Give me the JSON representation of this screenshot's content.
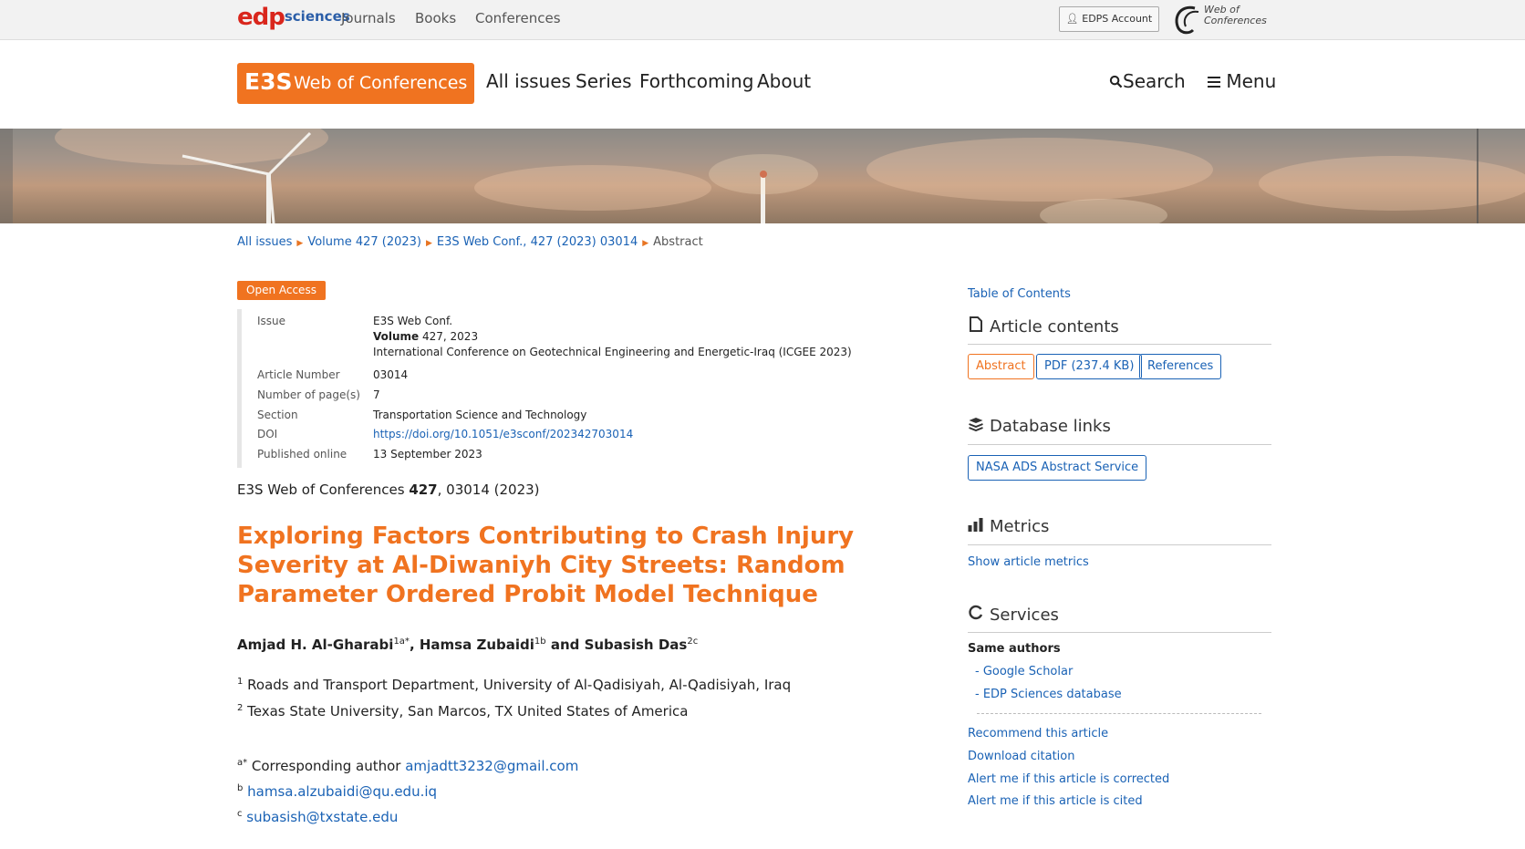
{
  "topbar": {
    "logo_main": "edp",
    "logo_suffix": "sciences",
    "nav": [
      "Journals",
      "Books",
      "Conferences"
    ],
    "account_label": "EDPS Account",
    "woc_logo_line1": "Web of",
    "woc_logo_line2": "Conferences"
  },
  "header": {
    "brand_e3s": "E3S",
    "brand_name": "Web of Conferences",
    "nav": [
      "All issues",
      "Series",
      "Forthcoming",
      "About"
    ],
    "search_label": "Search",
    "menu_label": "Menu"
  },
  "breadcrumb": [
    "All issues",
    "Volume 427 (2023)",
    "E3S Web Conf., 427 (2023) 03014",
    "Abstract"
  ],
  "badge": "Open Access",
  "meta": {
    "issue_label": "Issue",
    "issue_line1": "E3S Web Conf.",
    "issue_volume_bold": "Volume",
    "issue_volume_rest": " 427, 2023",
    "issue_line3": "International Conference on Geotechnical Engineering and Energetic-Iraq (ICGEE 2023)",
    "article_number_label": "Article Number",
    "article_number": "03014",
    "pages_label": "Number of page(s)",
    "pages": "7",
    "section_label": "Section",
    "section": "Transportation Science and Technology",
    "doi_label": "DOI",
    "doi": "https://doi.org/10.1051/e3sconf/202342703014",
    "published_label": "Published online",
    "published": "13 September 2023"
  },
  "citation": {
    "prefix": "E3S Web of Conferences ",
    "volume": "427",
    "suffix": ", 03014 (2023)"
  },
  "article": {
    "title": "Exploring Factors Contributing to Crash Injury Severity at Al-Diwaniyh City Streets: Random Parameter Ordered Probit Model Technique",
    "authors": [
      {
        "name": "Amjad H. Al-Gharabi",
        "sup": "1a*",
        "sep": ", "
      },
      {
        "name": "Hamsa Zubaidi",
        "sup": "1b",
        "sep": " and "
      },
      {
        "name": "Subasish Das",
        "sup": "2c",
        "sep": ""
      }
    ],
    "affiliations": [
      {
        "sup": "1",
        "text": " Roads and Transport Department, University of Al-Qadisiyah, Al-Qadisiyah, Iraq"
      },
      {
        "sup": "2",
        "text": " Texas State University, San Marcos, TX United States of America"
      }
    ],
    "correspondence": [
      {
        "sup": "a*",
        "label": " Corresponding author ",
        "email": "amjadtt3232@gmail.com"
      },
      {
        "sup": "b",
        "label": " ",
        "email": "hamsa.alzubaidi@qu.edu.iq"
      },
      {
        "sup": "c",
        "label": " ",
        "email": "subasish@txstate.edu"
      }
    ]
  },
  "sidebar": {
    "toc": "Table of Contents",
    "article_contents": "Article contents",
    "buttons": [
      "Abstract",
      "PDF (237.4 KB)",
      "References"
    ],
    "database_links": "Database links",
    "nasa": "NASA ADS Abstract Service",
    "metrics": "Metrics",
    "show_metrics": "Show article metrics",
    "services": "Services",
    "same_authors": "Same authors",
    "google_scholar": "- Google Scholar",
    "edp_db": "- EDP Sciences database",
    "recommend": "Recommend this article",
    "download_citation": "Download citation",
    "alert_corrected": "Alert me if this article is corrected",
    "alert_cited": "Alert me if this article is cited"
  },
  "colors": {
    "accent": "#f07320",
    "link": "#1a62b5"
  }
}
